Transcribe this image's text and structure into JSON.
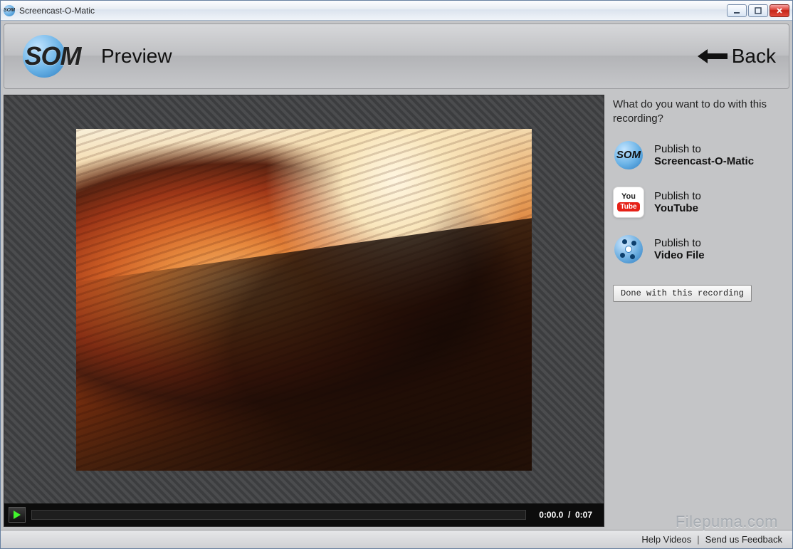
{
  "window_title": "Screencast-O-Matic",
  "header": {
    "logo_text": "SOM",
    "page_title": "Preview",
    "back_label": "Back"
  },
  "player": {
    "current_time": "0:00.0",
    "duration": "0:07"
  },
  "side": {
    "prompt": "What do you want to do with this recording?",
    "options": [
      {
        "line1": "Publish to",
        "line2": "Screencast-O-Matic",
        "icon": "som"
      },
      {
        "line1": "Publish to",
        "line2": "YouTube",
        "icon": "yt"
      },
      {
        "line1": "Publish to",
        "line2": "Video File",
        "icon": "file"
      }
    ],
    "done_label": "Done with this recording"
  },
  "footer": {
    "help_label": "Help Videos",
    "feedback_label": "Send us Feedback"
  },
  "watermark": "Filepuma.com",
  "icons": {
    "yt_you": "You",
    "yt_tube": "Tube",
    "som_tiny": "SOM"
  }
}
